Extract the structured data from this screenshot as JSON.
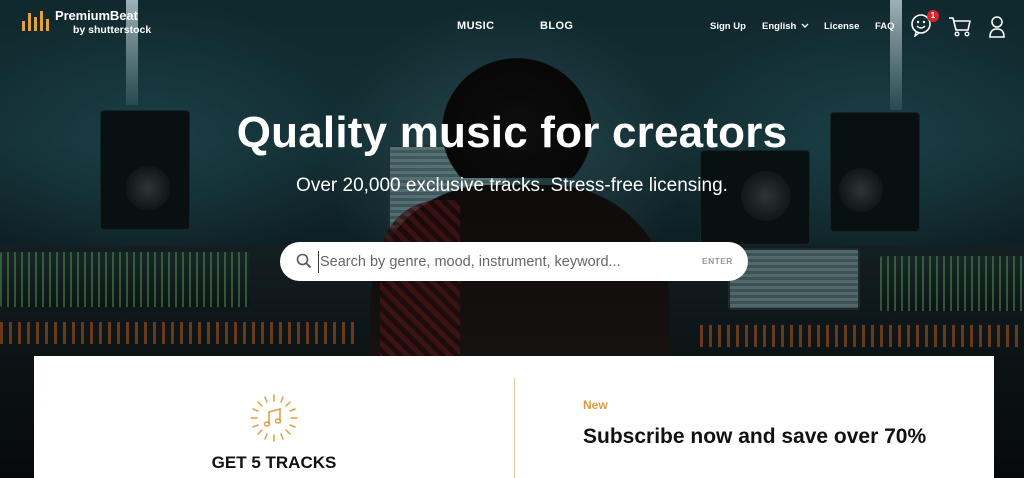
{
  "brand": {
    "name": "PremiumBeat",
    "sub": "by shutterstock",
    "accent_color": "#e0a043"
  },
  "nav": {
    "center": [
      {
        "label": "MUSIC"
      },
      {
        "label": "BLOG"
      }
    ],
    "right": [
      {
        "label": "Sign Up"
      },
      {
        "label": "English"
      },
      {
        "label": "License"
      },
      {
        "label": "FAQ"
      }
    ],
    "icons": {
      "support": "smiley-face-icon",
      "support_badge": "1",
      "cart": "cart-icon",
      "account": "user-icon",
      "language_chevron": "chevron-down-icon"
    }
  },
  "hero": {
    "title": "Quality music for creators",
    "subtitle": "Over 20,000 exclusive tracks. Stress-free licensing.",
    "search": {
      "placeholder": "Search by genre, mood, instrument, keyword...",
      "value": "",
      "enter_label": "ENTER"
    }
  },
  "promo": {
    "left_label": "GET 5 TRACKS",
    "left_icon": "music-note-sparkle-icon",
    "new_label": "New",
    "title": "Subscribe now and save over 70%",
    "new_color": "#d99b3b"
  }
}
